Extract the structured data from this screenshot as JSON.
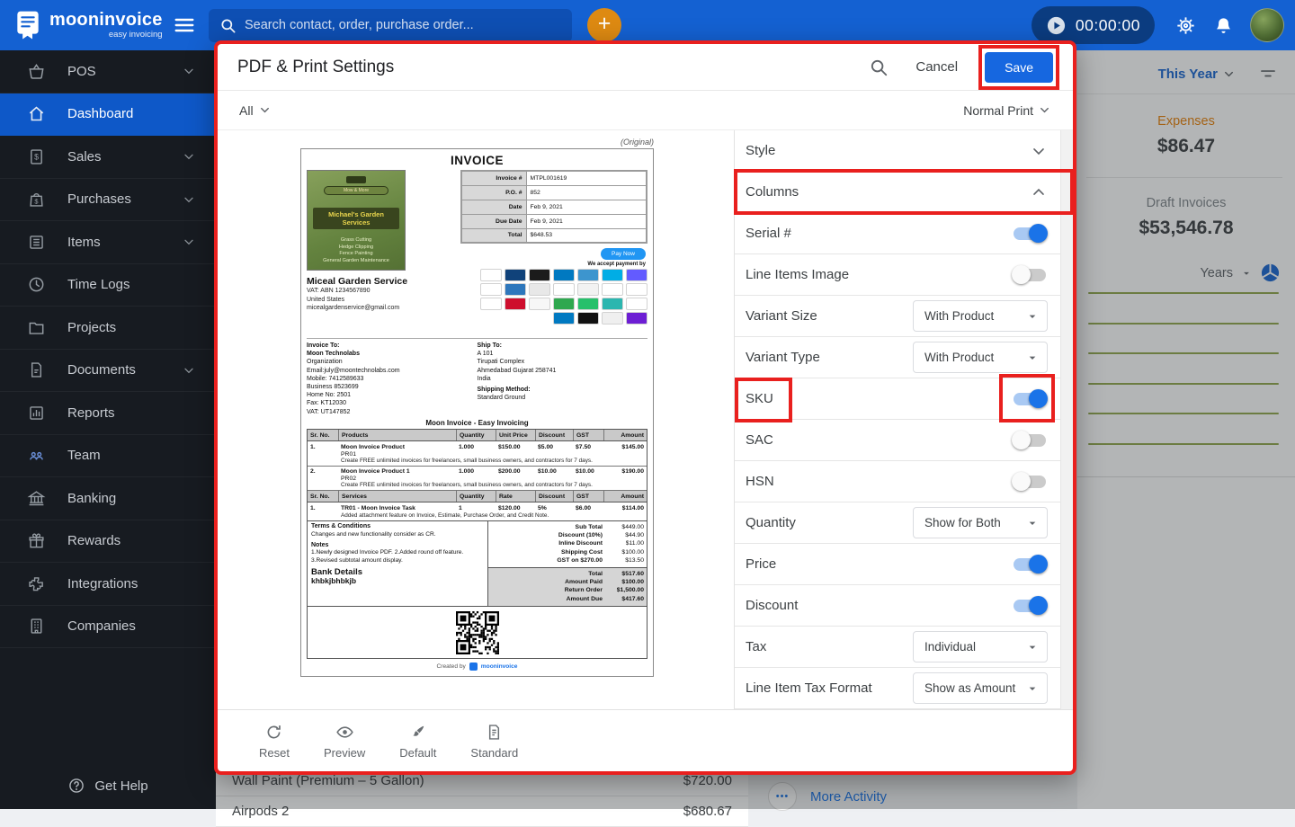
{
  "topbar": {
    "brand": "mooninvoice",
    "brand_tagline": "easy invoicing",
    "search_placeholder": "Search contact, order, purchase order...",
    "timer": "00:00:00"
  },
  "sidebar": {
    "items": [
      {
        "label": "POS",
        "icon": "basket",
        "chevron": true,
        "active": false
      },
      {
        "label": "Dashboard",
        "icon": "home",
        "chevron": false,
        "active": true
      },
      {
        "label": "Sales",
        "icon": "sales-doc",
        "chevron": true,
        "active": false
      },
      {
        "label": "Purchases",
        "icon": "shopping-bag",
        "chevron": true,
        "active": false
      },
      {
        "label": "Items",
        "icon": "items-list",
        "chevron": true,
        "active": false
      },
      {
        "label": "Time Logs",
        "icon": "clock",
        "chevron": false,
        "active": false
      },
      {
        "label": "Projects",
        "icon": "folder",
        "chevron": false,
        "active": false
      },
      {
        "label": "Documents",
        "icon": "document",
        "chevron": true,
        "active": false
      },
      {
        "label": "Reports",
        "icon": "bar-chart",
        "chevron": false,
        "active": false
      },
      {
        "label": "Team",
        "icon": "people",
        "chevron": false,
        "active": false,
        "icon_color": "#6A8FD8"
      },
      {
        "label": "Banking",
        "icon": "bank",
        "chevron": false,
        "active": false
      },
      {
        "label": "Rewards",
        "icon": "gift",
        "chevron": false,
        "active": false
      },
      {
        "label": "Integrations",
        "icon": "puzzle",
        "chevron": false,
        "active": false
      },
      {
        "label": "Companies",
        "icon": "building",
        "chevron": false,
        "active": false
      }
    ],
    "help_label": "Get Help"
  },
  "modal": {
    "title": "PDF & Print Settings",
    "cancel_label": "Cancel",
    "save_label": "Save",
    "filter_left": "All",
    "filter_right": "Normal Print",
    "settings": [
      {
        "label": "Style",
        "type": "section",
        "state": "collapsed"
      },
      {
        "label": "Columns",
        "type": "section",
        "state": "expanded",
        "highlighted": true
      },
      {
        "label": "Serial #",
        "type": "toggle",
        "value": true
      },
      {
        "label": "Line Items Image",
        "type": "toggle",
        "value": false
      },
      {
        "label": "Variant Size",
        "type": "select",
        "value": "With Product"
      },
      {
        "label": "Variant Type",
        "type": "select",
        "value": "With Product"
      },
      {
        "label": "SKU",
        "type": "toggle",
        "value": true,
        "highlight_label": true,
        "highlight_control": true
      },
      {
        "label": "SAC",
        "type": "toggle",
        "value": false
      },
      {
        "label": "HSN",
        "type": "toggle",
        "value": false
      },
      {
        "label": "Quantity",
        "type": "select",
        "value": "Show for Both"
      },
      {
        "label": "Price",
        "type": "toggle",
        "value": true
      },
      {
        "label": "Discount",
        "type": "toggle",
        "value": true
      },
      {
        "label": "Tax",
        "type": "select",
        "value": "Individual"
      },
      {
        "label": "Line Item Tax Format",
        "type": "select",
        "value": "Show as Amount"
      }
    ],
    "toolbar": [
      {
        "label": "Reset",
        "icon": "refresh"
      },
      {
        "label": "Preview",
        "icon": "eye"
      },
      {
        "label": "Default",
        "icon": "brush"
      },
      {
        "label": "Standard",
        "icon": "standard-doc"
      }
    ],
    "accent_color": "#1667E0",
    "annotation_color": "#E9201E"
  },
  "invoice": {
    "original_label": "(Original)",
    "title": "INVOICE",
    "logo": {
      "name": "Michael's Garden Services",
      "badge": "Mow & More",
      "services": [
        "Grass Cutting",
        "Hedge Clipping",
        "Fence Painting",
        "General Garden Maintenance"
      ]
    },
    "company": {
      "name": "Miceal Garden Service",
      "vat": "VAT: ABN 1234567890",
      "country": "United States",
      "email": "micealgardenservice@gmail.com"
    },
    "meta": [
      [
        "Invoice #",
        "MTPL001619"
      ],
      [
        "P.O. #",
        "852"
      ],
      [
        "Date",
        "Feb 9, 2021"
      ],
      [
        "Due Date",
        "Feb 9, 2021"
      ],
      [
        "Total",
        "$648.53"
      ]
    ],
    "pay_now": "Pay Now",
    "accept_label": "We accept payment by",
    "payment_chips": [
      [
        "#FFFFFF",
        "#10427A",
        "#1B1B1B",
        "#0079C1",
        "#3D95CE",
        "#00ADE5",
        "#635BFF"
      ],
      [
        "#FFFFFF",
        "#2E77BC",
        "#E8E8E8",
        "#FFFFFF",
        "#F2F2F2",
        "#FFFFFF",
        "#FFFFFF"
      ],
      [
        "#FFFFFF",
        "#CE0E2D",
        "#F7F7F7",
        "#2FA84F",
        "#27C06B",
        "#2BB6AF",
        "#FFFFFF"
      ],
      [
        "#0079C1",
        "#111111",
        "#EFEFEF",
        "#6D1ED4"
      ]
    ],
    "invoice_to": {
      "heading": "Invoice To:",
      "lines": [
        "Moon Technolabs",
        "Organization",
        "Email:july@moontechnolabs.com",
        "Mobile: 7412589633",
        "Business 8523699",
        "Home No: 2501",
        "Fax: KT12030",
        "VAT: UT147852"
      ]
    },
    "ship_to": {
      "heading": "Ship To:",
      "lines": [
        "A 101",
        "Tirupati Complex",
        "Ahmedabad Gujarat 258741",
        "India"
      ],
      "method_heading": "Shipping Method:",
      "method": "Standard Ground"
    },
    "tagline": "Moon Invoice - Easy Invoicing",
    "products_table": {
      "headers": [
        "Sr. No.",
        "Products",
        "Quantity",
        "Unit Price",
        "Discount",
        "GST",
        "Amount"
      ],
      "rows": [
        {
          "no": "1.",
          "name": "Moon Invoice Product",
          "code": "PR01",
          "desc": "Create FREE unlimited invoices for freelancers, small business owners, and contractors for 7 days.",
          "qty": "1.000",
          "price": "$150.00",
          "discount": "$5.00",
          "gst": "$7.50",
          "amount": "$145.00"
        },
        {
          "no": "2.",
          "name": "Moon Invoice Product 1",
          "code": "PR02",
          "desc": "Create FREE unlimited invoices for freelancers, small business owners, and contractors for 7 days.",
          "qty": "1.000",
          "price": "$200.00",
          "discount": "$10.00",
          "gst": "$10.00",
          "amount": "$190.00"
        }
      ]
    },
    "services_table": {
      "headers": [
        "Sr. No.",
        "Services",
        "Quantity",
        "Rate",
        "Discount",
        "GST",
        "Amount"
      ],
      "rows": [
        {
          "no": "1.",
          "name": "TR01 - Moon Invoice Task",
          "code": "",
          "desc": "Added attachment feature on Invoice, Estimate, Purchase Order, and Credit Note.",
          "qty": "1",
          "price": "$120.00",
          "discount": "5%",
          "gst": "$6.00",
          "amount": "$114.00"
        }
      ]
    },
    "terms": {
      "heading": "Terms & Conditions",
      "text": "Changes and new functionality consider as CR.",
      "notes_heading": "Notes",
      "notes": "1.Newly designed Invoice PDF.  2.Added round off feature. 3.Revised subtotal amount display.",
      "bank_heading": "Bank Details",
      "bank": "khbkjbhbkjb"
    },
    "totals": [
      [
        "Sub Total",
        "$449.00"
      ],
      [
        "Discount (10%)",
        "$44.90"
      ],
      [
        "Inline Discount",
        "$11.00"
      ],
      [
        "Shipping Cost",
        "$100.00"
      ],
      [
        "GST on $270.00",
        "$13.50"
      ]
    ],
    "grand_totals": [
      [
        "Total",
        "$517.60"
      ],
      [
        "Amount Paid",
        "$100.00"
      ],
      [
        "Return Order",
        "$1,500.00"
      ],
      [
        "Amount Due",
        "$417.60"
      ]
    ],
    "created_by": "Created by",
    "created_brand": "mooninvoice"
  },
  "dashboard": {
    "period": "This Year",
    "stats": [
      {
        "label": "Expenses",
        "value": "$86.47",
        "label_color": "#E8820C"
      },
      {
        "label": "Draft Invoices",
        "value": "$53,546.78",
        "label_color": "#80868B"
      }
    ],
    "years_label": "Years",
    "rows": [
      {
        "name": "Wall Paint (Premium – 5 Gallon)",
        "amount": "$720.00"
      },
      {
        "name": "Airpods 2",
        "amount": "$680.67"
      }
    ],
    "more_activity": "More Activity",
    "more_dots": "•••"
  }
}
